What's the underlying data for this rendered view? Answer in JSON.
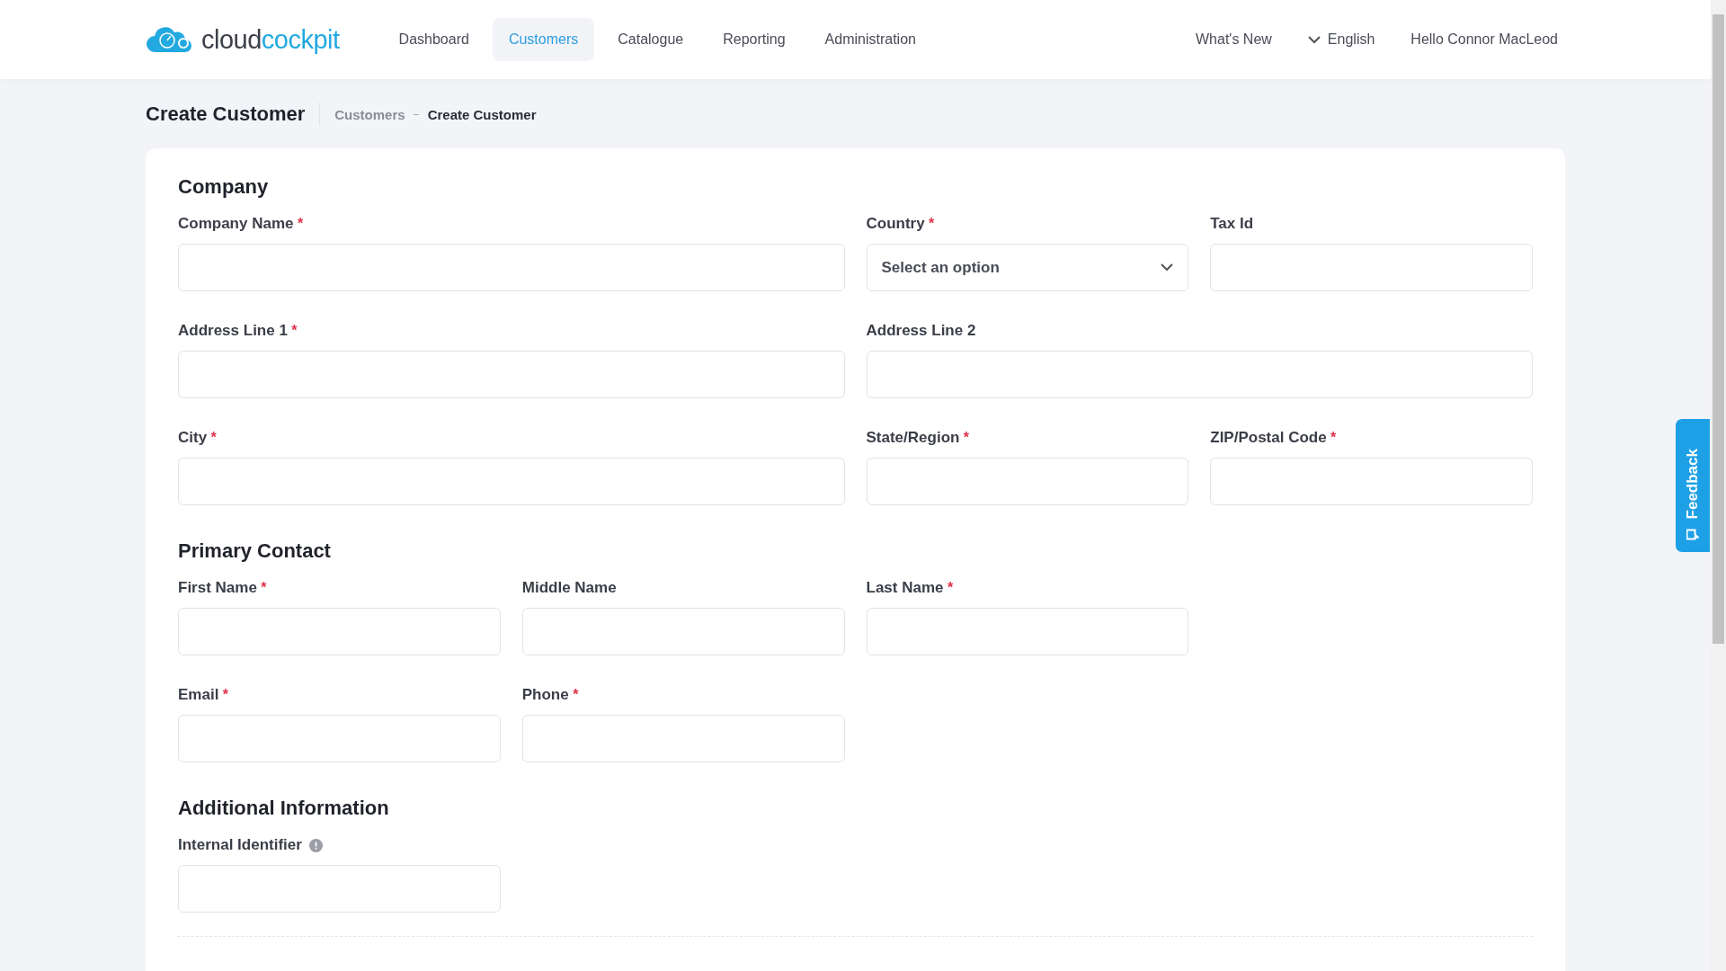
{
  "brand": {
    "name_dark": "cloud",
    "name_accent": "cockpit"
  },
  "nav": [
    {
      "label": "Dashboard",
      "selected": false
    },
    {
      "label": "Customers",
      "selected": true
    },
    {
      "label": "Catalogue",
      "selected": false
    },
    {
      "label": "Reporting",
      "selected": false
    },
    {
      "label": "Administration",
      "selected": false
    }
  ],
  "header_right": {
    "whats_new": "What's New",
    "language": "English",
    "greeting": "Hello Connor MacLeod"
  },
  "page_title": "Create Customer",
  "breadcrumb": [
    {
      "label": "Customers",
      "current": false
    },
    {
      "label": "Create Customer",
      "current": true
    }
  ],
  "sections": [
    {
      "title": "Company",
      "kind": "address",
      "rows": [
        [
          {
            "label": "Company Name",
            "required": true,
            "kind": "text"
          },
          {
            "label": "Country",
            "required": true,
            "kind": "select",
            "placeholder": "Select an option"
          },
          {
            "label": "Tax Id",
            "required": false,
            "kind": "text"
          }
        ],
        [
          {
            "label": "Address Line 1",
            "required": true,
            "kind": "text"
          },
          {
            "label": "Address Line 2",
            "required": false,
            "kind": "text"
          }
        ],
        [
          {
            "label": "City",
            "required": true,
            "kind": "text"
          },
          {
            "label": "State/Region",
            "required": true,
            "kind": "text"
          },
          {
            "label": "ZIP/Postal Code",
            "required": true,
            "kind": "text"
          }
        ]
      ]
    },
    {
      "title": "Primary Contact",
      "kind": "contact",
      "rows": [
        [
          {
            "label": "First Name",
            "required": true,
            "kind": "text"
          },
          {
            "label": "Middle Name",
            "required": false,
            "kind": "text"
          },
          {
            "label": "Last Name",
            "required": true,
            "kind": "text"
          }
        ],
        [
          {
            "label": "Email",
            "required": true,
            "kind": "text"
          },
          {
            "label": "Phone",
            "required": true,
            "kind": "text"
          }
        ]
      ]
    },
    {
      "title": "Additional Information",
      "kind": "contact",
      "rows": [
        [
          {
            "label": "Internal Identifier",
            "required": false,
            "kind": "text",
            "info": true
          }
        ]
      ]
    }
  ],
  "required_mark": "*",
  "feedback": {
    "label": "Feedback"
  }
}
